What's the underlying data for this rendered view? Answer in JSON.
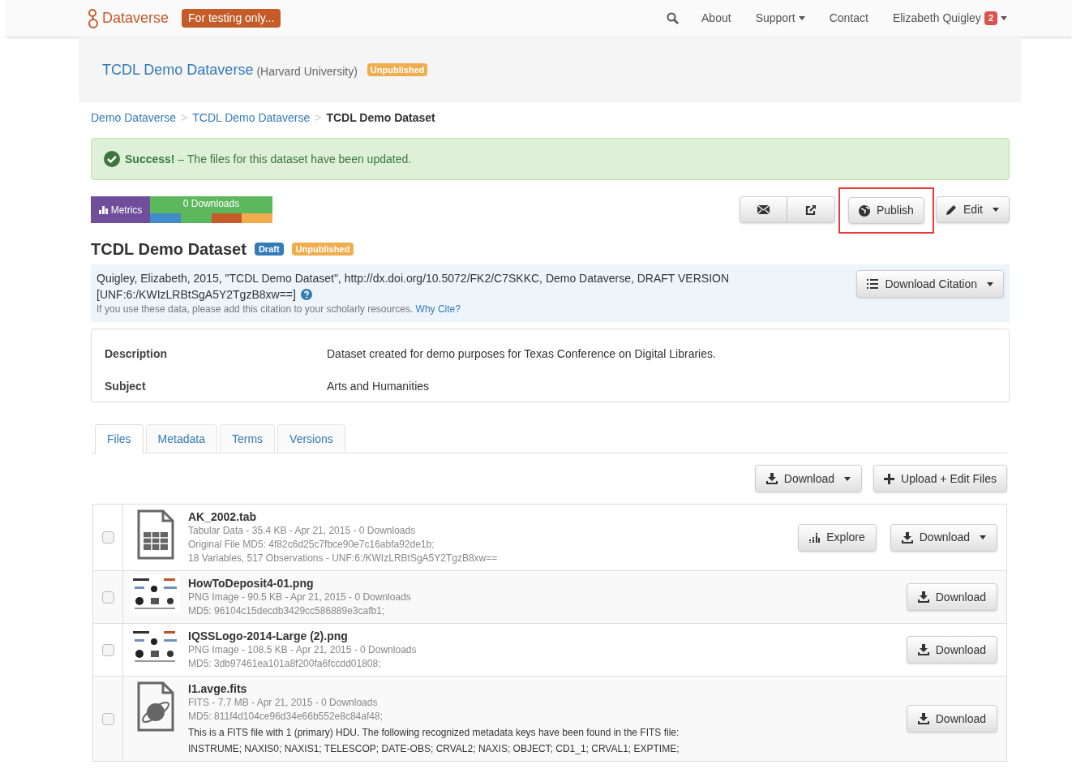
{
  "navbar": {
    "brand": "Dataverse",
    "test_badge": "For testing only...",
    "links": [
      {
        "label": "About",
        "dropdown": false
      },
      {
        "label": "Support",
        "dropdown": true
      },
      {
        "label": "Contact",
        "dropdown": false
      }
    ],
    "user": {
      "name": "Elizabeth Quigley",
      "badge": "2"
    }
  },
  "header": {
    "title": "TCDL Demo Dataverse",
    "affiliation": "(Harvard University)",
    "badge": "Unpublished"
  },
  "breadcrumbs": [
    {
      "label": "Demo Dataverse",
      "current": false
    },
    {
      "label": "TCDL Demo Dataverse",
      "current": false
    },
    {
      "label": "TCDL Demo Dataset",
      "current": true
    }
  ],
  "breadcrumb_separators": [
    ">",
    ">"
  ],
  "alert": {
    "strong": "Success!",
    "text": "– The files for this dataset have been updated."
  },
  "metrics": {
    "label": "Metrics",
    "downloads": "0 Downloads"
  },
  "actions": {
    "publish": {
      "label": "Publish",
      "highlighted": true
    },
    "edit": {
      "label": "Edit"
    }
  },
  "dataset": {
    "title": "TCDL Demo Dataset",
    "badges": [
      {
        "label": "Draft",
        "kind": "draft"
      },
      {
        "label": "Unpublished",
        "kind": "unpublished"
      }
    ]
  },
  "citation": {
    "text": "Quigley, Elizabeth, 2015, \"TCDL Demo Dataset\", http://dx.doi.org/10.5072/FK2/C7SKKC, Demo Dataverse, DRAFT VERSION",
    "unf": "[UNF:6:/KWIzLRBtSgA5Y2TgzB8xw==]",
    "note": "If you use these data, please add this citation to your scholarly resources.",
    "link": "Why Cite?",
    "button": "Download Citation"
  },
  "metadata": [
    {
      "label": "Description",
      "value": "Dataset created for demo purposes for Texas Conference on Digital Libraries."
    },
    {
      "label": "Subject",
      "value": "Arts and Humanities"
    }
  ],
  "tabs": [
    {
      "label": "Files",
      "selected": true
    },
    {
      "label": "Metadata",
      "selected": false
    },
    {
      "label": "Terms",
      "selected": false
    },
    {
      "label": "Versions",
      "selected": false
    }
  ],
  "file_actions": {
    "download": "Download",
    "upload": "Upload + Edit Files"
  },
  "files": [
    {
      "name": "AK_2002.tab",
      "kind": "table",
      "checked": false,
      "lines": [
        "Tabular Data - 35.4 KB - Apr 21, 2015 - 0 Downloads",
        "Original File MD5: 4f82c6d25c7fbce90e7c16abfa92de1b;",
        "18 Variables, 517 Observations - UNF:6:/KWIzLRBtSgA5Y2TgzB8xw=="
      ],
      "buttons": [
        {
          "label": "Explore",
          "kind": "explore",
          "dropdown": false
        },
        {
          "label": "Download",
          "kind": "download",
          "dropdown": true
        }
      ]
    },
    {
      "name": "HowToDeposit4-01.png",
      "kind": "picture",
      "checked": false,
      "lines": [
        "PNG Image - 90.5 KB - Apr 21, 2015 - 0 Downloads",
        "MD5: 96104c15decdb3429cc586889e3cafb1;"
      ],
      "buttons": [
        {
          "label": "Download",
          "kind": "download",
          "dropdown": false
        }
      ]
    },
    {
      "name": "IQSSLogo-2014-Large (2).png",
      "kind": "picture",
      "checked": false,
      "lines": [
        "PNG Image - 108.5 KB - Apr 21, 2015 - 0 Downloads",
        "MD5: 3db97461ea101a8f200fa6fccdd01808;"
      ],
      "buttons": [
        {
          "label": "Download",
          "kind": "download",
          "dropdown": false
        }
      ]
    },
    {
      "name": "I1.avge.fits",
      "kind": "fits",
      "checked": false,
      "lines": [
        "FITS - 7.7 MB - Apr 21, 2015 - 0 Downloads",
        "MD5: 811f4d104ce96d34e66b552e8c84af48;"
      ],
      "notes": [
        "This is a FITS file with 1 (primary) HDU. The following recognized metadata keys have been found in the FITS file:",
        "INSTRUME; NAXIS0; NAXIS1; TELESCOP; DATE-OBS; CRVAL2; NAXIS; OBJECT; CD1_1; CRVAL1; EXPTIME;"
      ],
      "buttons": [
        {
          "label": "Download",
          "kind": "download",
          "dropdown": false
        }
      ]
    }
  ]
}
